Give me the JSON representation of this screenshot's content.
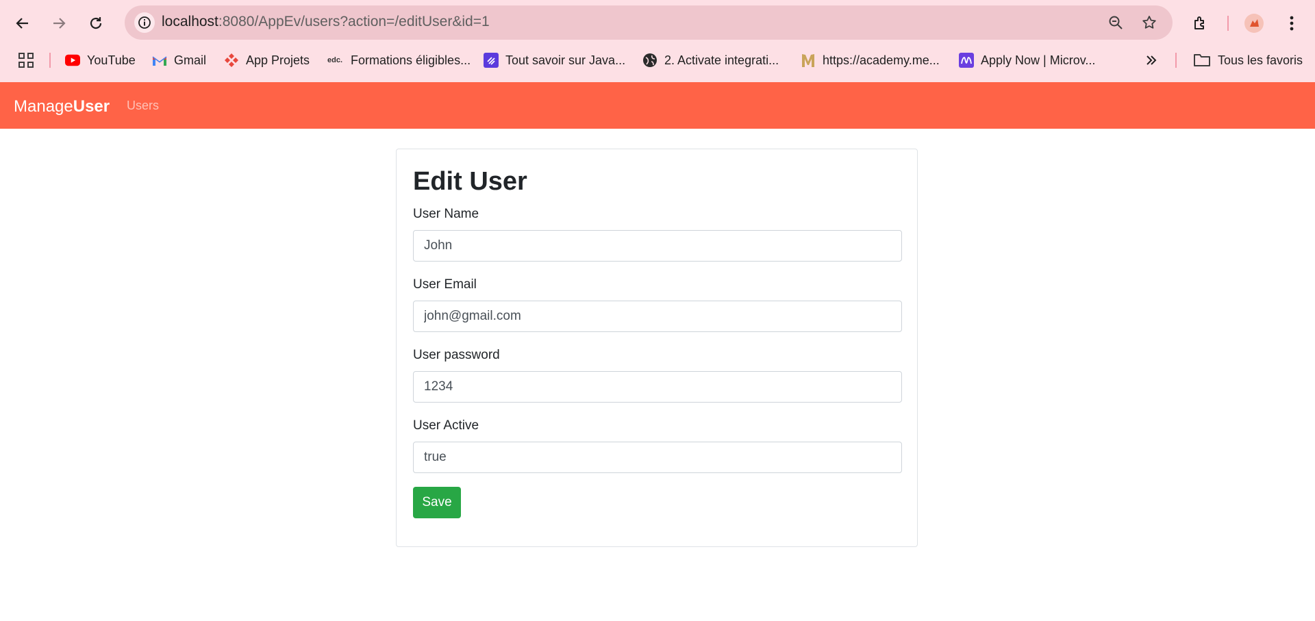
{
  "browser": {
    "url_host": "localhost",
    "url_rest": ":8080/AppEv/users?action=/editUser&id=1",
    "bookmarks": [
      {
        "icon": "youtube-icon",
        "label": "YouTube"
      },
      {
        "icon": "gmail-icon",
        "label": "Gmail"
      },
      {
        "icon": "app-projets-icon",
        "label": "App Projets"
      },
      {
        "icon": "edc-icon",
        "label": "Formations éligibles..."
      },
      {
        "icon": "java-icon",
        "label": "Tout savoir sur Java..."
      },
      {
        "icon": "globe-icon",
        "label": "2. Activate integrati..."
      },
      {
        "icon": "academy-icon",
        "label": "https://academy.me..."
      },
      {
        "icon": "microsoft-icon",
        "label": "Apply Now | Microv..."
      }
    ],
    "all_bookmarks_label": "Tous les favoris"
  },
  "navbar": {
    "brand_part1": "Manage",
    "brand_part2": "User",
    "link": "Users",
    "color": "#ff6347"
  },
  "form": {
    "title": "Edit User",
    "fields": [
      {
        "label": "User Name",
        "value": "John"
      },
      {
        "label": "User Email",
        "value": "john@gmail.com"
      },
      {
        "label": "User password",
        "value": "1234"
      },
      {
        "label": "User Active",
        "value": "true"
      }
    ],
    "save_label": "Save",
    "save_color": "#28a745"
  }
}
